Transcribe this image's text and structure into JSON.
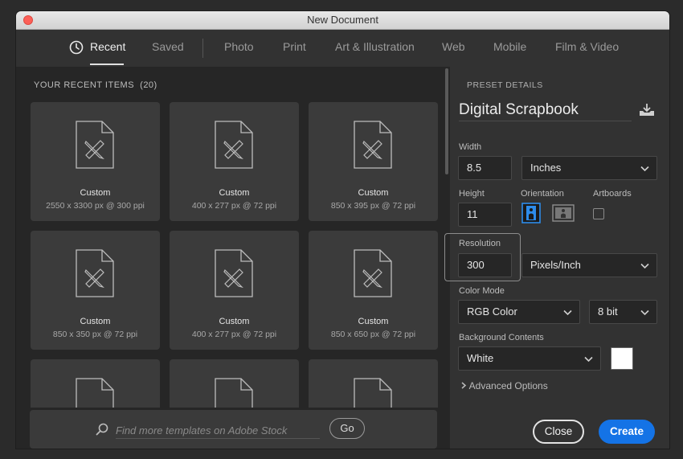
{
  "window": {
    "title": "New Document"
  },
  "tabs": [
    {
      "label": "Recent",
      "icon": "clock-icon",
      "active": true
    },
    {
      "label": "Saved"
    },
    {
      "label": "Photo"
    },
    {
      "label": "Print"
    },
    {
      "label": "Art & Illustration"
    },
    {
      "label": "Web"
    },
    {
      "label": "Mobile"
    },
    {
      "label": "Film & Video"
    }
  ],
  "recent": {
    "header": "YOUR RECENT ITEMS",
    "count": "(20)",
    "items": [
      {
        "name": "Custom",
        "size": "2550 x 3300 px @ 300 ppi"
      },
      {
        "name": "Custom",
        "size": "400 x 277 px @ 72 ppi"
      },
      {
        "name": "Custom",
        "size": "850 x 395 px @ 72 ppi"
      },
      {
        "name": "Custom",
        "size": "850 x 350 px @ 72 ppi"
      },
      {
        "name": "Custom",
        "size": "400 x 277 px @ 72 ppi"
      },
      {
        "name": "Custom",
        "size": "850 x 650 px @ 72 ppi"
      }
    ]
  },
  "stock_search": {
    "placeholder": "Find more templates on Adobe Stock",
    "go_label": "Go"
  },
  "preset": {
    "section_label": "PRESET DETAILS",
    "name": "Digital Scrapbook",
    "width_label": "Width",
    "width_value": "8.5",
    "width_unit": "Inches",
    "height_label": "Height",
    "height_value": "11",
    "orientation_label": "Orientation",
    "orientation_selected": "portrait",
    "artboards_label": "Artboards",
    "artboards_checked": false,
    "resolution_label": "Resolution",
    "resolution_value": "300",
    "resolution_unit": "Pixels/Inch",
    "color_mode_label": "Color Mode",
    "color_mode": "RGB Color",
    "bit_depth": "8 bit",
    "background_label": "Background Contents",
    "background": "White",
    "background_swatch": "#ffffff",
    "advanced_label": "Advanced Options"
  },
  "actions": {
    "close_label": "Close",
    "create_label": "Create"
  },
  "colors": {
    "accent": "#1473e6",
    "window_bg": "#323232",
    "panel_bg": "#262626",
    "card_bg": "#3b3b3b"
  }
}
